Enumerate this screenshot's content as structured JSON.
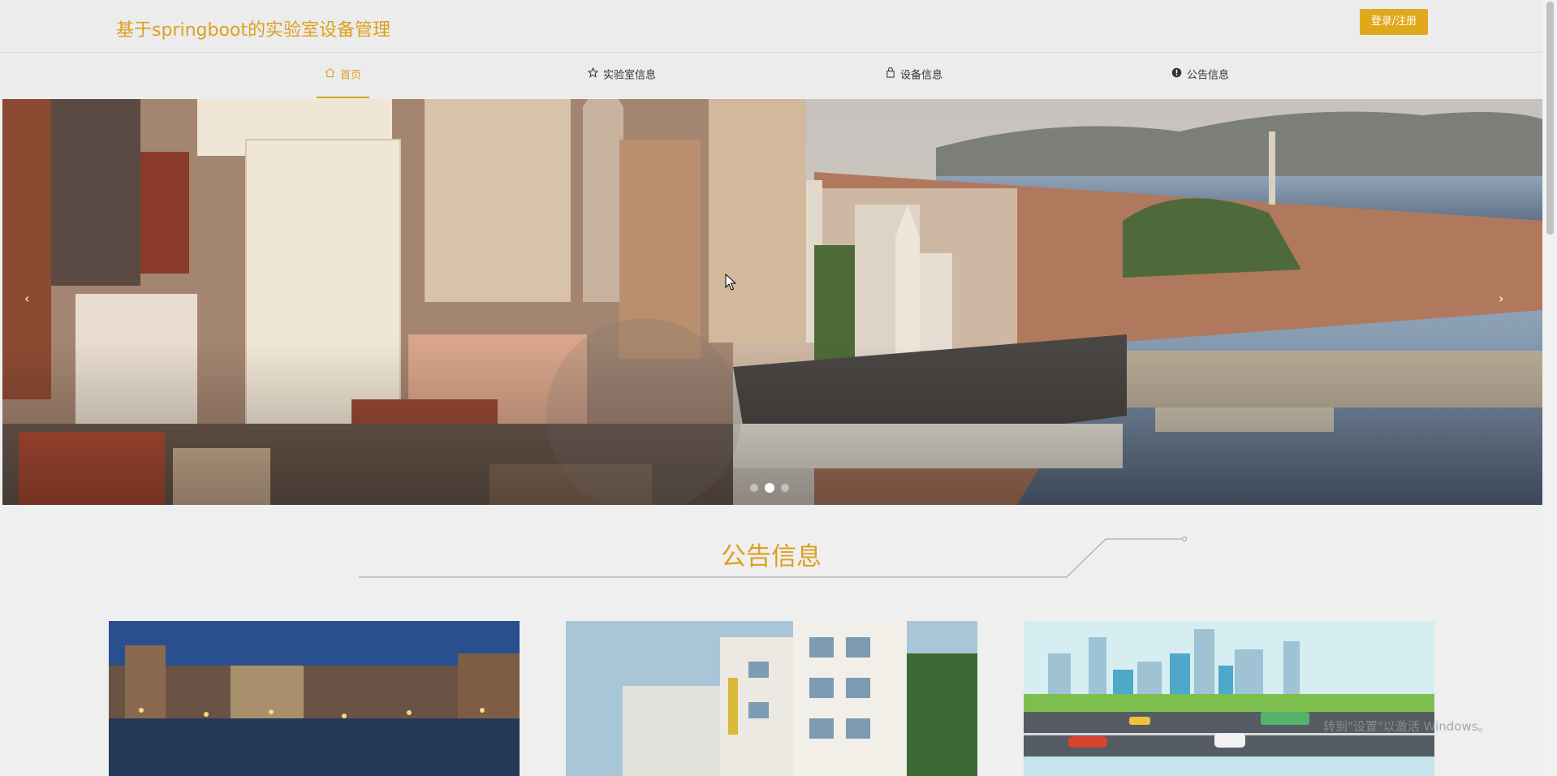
{
  "header": {
    "title": "基于springboot的实验室设备管理",
    "login_label": "登录/注册"
  },
  "nav": {
    "items": [
      {
        "label": "首页",
        "icon": "home-icon",
        "active": true
      },
      {
        "label": "实验室信息",
        "icon": "star-icon",
        "active": false
      },
      {
        "label": "设备信息",
        "icon": "bag-icon",
        "active": false
      },
      {
        "label": "公告信息",
        "icon": "info-icon",
        "active": false
      }
    ]
  },
  "carousel": {
    "slide_count": 3,
    "active_index": 1,
    "prev_icon": "chevron-left-icon",
    "next_icon": "chevron-right-icon"
  },
  "section": {
    "title": "公告信息"
  },
  "cards": [
    {
      "image": "venice-canal-night"
    },
    {
      "image": "apartment-building"
    },
    {
      "image": "city-street-illustration"
    }
  ],
  "watermark": "转到\"设置\"以激活 Windows。",
  "colors": {
    "accent": "#dba11f",
    "button": "#e0a91c"
  }
}
